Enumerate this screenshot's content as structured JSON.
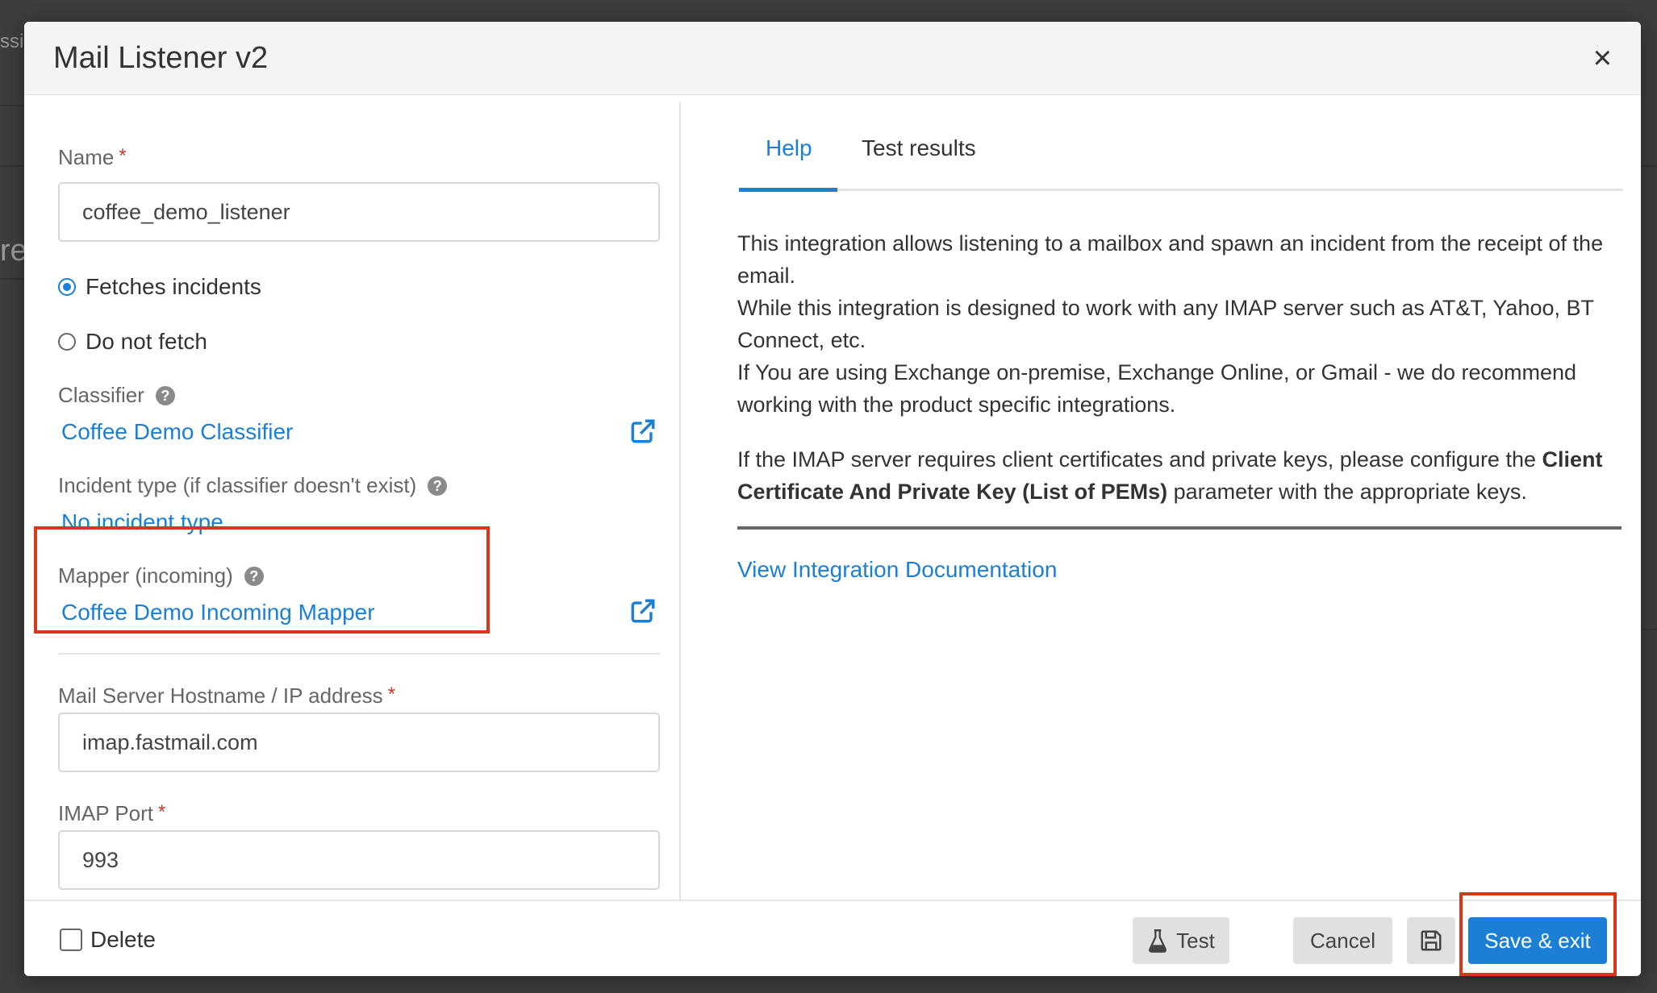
{
  "background": {
    "fragments": [
      "ssi",
      "re"
    ]
  },
  "modal": {
    "title": "Mail Listener v2",
    "close_label": "×"
  },
  "form": {
    "name": {
      "label": "Name",
      "required_mark": "*",
      "value": "coffee_demo_listener"
    },
    "fetch_options": [
      {
        "label": "Fetches incidents",
        "checked": true
      },
      {
        "label": "Do not fetch",
        "checked": false
      }
    ],
    "classifier": {
      "label": "Classifier",
      "value": "Coffee Demo Classifier"
    },
    "incident_type": {
      "label": "Incident type (if classifier doesn't exist)",
      "value": "No incident type"
    },
    "mapper": {
      "label": "Mapper (incoming)",
      "value": "Coffee Demo Incoming Mapper"
    },
    "hostname": {
      "label": "Mail Server Hostname / IP address",
      "required_mark": "*",
      "value": "imap.fastmail.com"
    },
    "port": {
      "label": "IMAP Port",
      "required_mark": "*",
      "value": "993"
    },
    "help_glyph": "?"
  },
  "tabs": [
    {
      "label": "Help",
      "active": true
    },
    {
      "label": "Test results",
      "active": false
    }
  ],
  "help": {
    "paragraph1": "This integration allows listening to a mailbox and spawn an incident from the receipt of the email.",
    "paragraph2": "While this integration is designed to work with any IMAP server such as AT&T, Yahoo, BT Connect, etc.",
    "paragraph3": "If You are using Exchange on-premise, Exchange Online, or Gmail - we do recommend working with the product specific integrations.",
    "paragraph4_before": "If the IMAP server requires client certificates and private keys, please configure the ",
    "paragraph4_bold": "Client Certificate And Private Key (List of PEMs)",
    "paragraph4_after": " parameter with the appropriate keys.",
    "doc_link": "View Integration Documentation"
  },
  "footer": {
    "delete_label": "Delete",
    "delete_checked": false,
    "test_label": "Test",
    "cancel_label": "Cancel",
    "save_exit_label": "Save & exit"
  },
  "colors": {
    "accent": "#1b7fd4",
    "highlight_box": "#d9361e",
    "required": "#c0392b"
  }
}
